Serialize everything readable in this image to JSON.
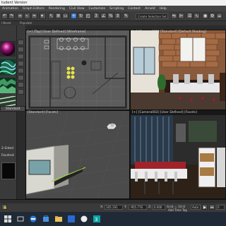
{
  "window": {
    "title": "tudent Version"
  },
  "menu": [
    "Animation",
    "Graph Editors",
    "Rendering",
    "Civil View",
    "Customize",
    "Scripting",
    "Content",
    "Arnold",
    "Help"
  ],
  "toolbar": {
    "selection_set_placeholder": "Create Selection Set"
  },
  "subbar": {
    "left_label": "l Bevel",
    "populate_label": "Populate"
  },
  "viewports": {
    "top": {
      "label": "[+] [Top] [User Defined] [Wireframe]"
    },
    "camera1": {
      "label": "[+] [Camera001] [Standard] [Default Shading]"
    },
    "perspective": {
      "label": "[Standard] [Facets]"
    },
    "camera2": {
      "label": "[+] [Camera002] [User Defined] [Facets]"
    }
  },
  "left_panel": {
    "material_type": "Standard",
    "sided_label": "2-Sided",
    "faceted_label": "Faceted",
    "spin_value": "0"
  },
  "status": {
    "x_label": "X:",
    "x_value": "105.191",
    "y_label": "Y:",
    "y_value": "-955.776",
    "z_label": "Z:",
    "z_value": "0.000",
    "grid_label": "Grid = 10.0",
    "add_time_tag": "Add Time Tag",
    "mode_label": "Auto",
    "frame_value": "0"
  },
  "colors": {
    "accent": "#3d7ad6",
    "taskbar": "#1f2a36"
  }
}
